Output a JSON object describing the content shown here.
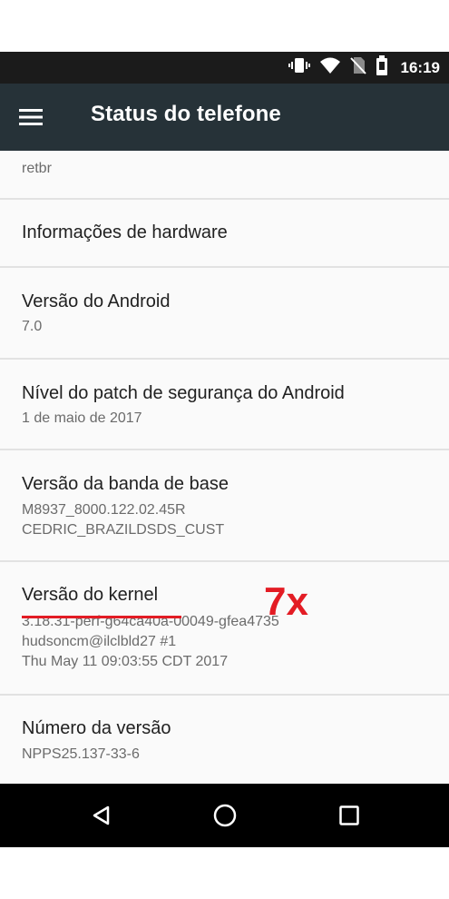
{
  "status_bar": {
    "time": "16:19",
    "icons": [
      "vibrate-icon",
      "wifi-icon",
      "no-sim-icon",
      "battery-icon"
    ]
  },
  "app_bar": {
    "title": "Status do telefone",
    "menu_icon": "menu-icon"
  },
  "items": [
    {
      "subtitle_lines": [
        "retbr"
      ]
    },
    {
      "title": "Informações de hardware"
    },
    {
      "title": "Versão do Android",
      "subtitle_lines": [
        "7.0"
      ]
    },
    {
      "title": "Nível do patch de segurança do Android",
      "subtitle_lines": [
        "1 de maio de 2017"
      ]
    },
    {
      "title": "Versão da banda de base",
      "subtitle_lines": [
        "M8937_8000.122.02.45R",
        "CEDRIC_BRAZILDSDS_CUST"
      ]
    },
    {
      "title": "Versão do kernel",
      "subtitle_lines": [
        "3.18.31-perf-g64ca40a-00049-gfea4735",
        "hudsoncm@ilclbld27 #1",
        "Thu May 11 09:03:55 CDT 2017"
      ]
    },
    {
      "title": "Número da versão",
      "subtitle_lines": [
        "NPPS25.137-33-6"
      ]
    }
  ],
  "annotation": {
    "text": "7x",
    "color": "#e31c24"
  },
  "nav_bar": {
    "buttons": [
      "back-icon",
      "home-icon",
      "recents-icon"
    ]
  },
  "colors": {
    "app_bar": "#263238",
    "status_bar": "#1b1b1b",
    "nav_bar": "#000000",
    "accent": "#e31c24"
  }
}
